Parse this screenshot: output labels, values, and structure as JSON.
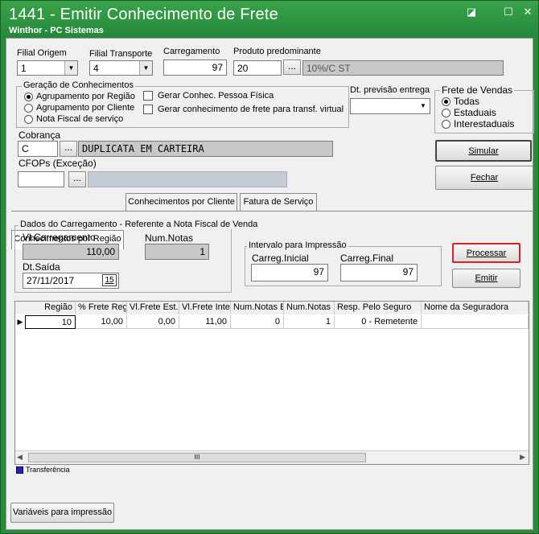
{
  "window": {
    "title": "1441 - Emitir Conhecimento de Frete",
    "subtitle": "Winthor - PC Sistemas",
    "controls": [
      "◪",
      "☐",
      "✕"
    ]
  },
  "header": {
    "filial_origem": {
      "label": "Filial Origem",
      "value": "1"
    },
    "filial_transporte": {
      "label": "Filial Transporte",
      "value": "4"
    },
    "carregamento": {
      "label": "Carregamento",
      "value": "97"
    },
    "produto": {
      "label": "Produto predominante",
      "code": "20",
      "btn": "...",
      "desc": "10%/C ST"
    }
  },
  "geracao": {
    "title": "Geração de Conhecimentos",
    "options": [
      {
        "label": "Agrupamento por Região",
        "checked": true
      },
      {
        "label": "Agrupamento por Cliente",
        "checked": false
      },
      {
        "label": "Nota Fiscal de serviço",
        "checked": false
      }
    ],
    "checks": [
      {
        "label": "Gerar Conhec. Pessoa Física"
      },
      {
        "label": "Gerar conhecimento de frete para transf. virtual"
      }
    ]
  },
  "previsao": {
    "label": "Dt. previsão entrega",
    "value": ""
  },
  "frete_vendas": {
    "title": "Frete de Vendas",
    "options": [
      {
        "label": "Todas",
        "checked": true
      },
      {
        "label": "Estaduais",
        "checked": false
      },
      {
        "label": "Interestaduais",
        "checked": false
      }
    ]
  },
  "cobranca": {
    "label": "Cobrança",
    "code": "C",
    "btn": "...",
    "desc": "DUPLICATA EM CARTEIRA"
  },
  "cfops": {
    "label": "CFOPs  (Exceção)",
    "btn": "..."
  },
  "buttons": {
    "simular": "Simular",
    "fechar": "Fechar",
    "processar": "Processar",
    "emitir": "Emitir",
    "variaveis": "Variáveis para impressão"
  },
  "tabs": [
    "Conhecimentos por Região",
    "Conhecimentos por Cliente",
    "Fatura de Serviço"
  ],
  "dados": {
    "title": "Dados do Carregamento - Referente a Nota Fiscal de Venda",
    "vl_label": "Vl.Carregamento",
    "vl_value": "110,00",
    "num_label": "Num.Notas",
    "num_value": "1",
    "dt_label": "Dt.Saída",
    "dt_value": "27/11/2017",
    "dt_icon": "15"
  },
  "intervalo": {
    "title": "Intervalo para Impressão",
    "inicial_label": "Carreg.Inicial",
    "inicial_value": "97",
    "final_label": "Carreg.Final",
    "final_value": "97"
  },
  "table": {
    "columns": [
      "Região",
      "% Frete Reg",
      "Vl.Frete Est.",
      "Vl.Frete Inte",
      "Num.Notas E",
      "Num.Notas I",
      "Resp. Pelo Seguro",
      "Nome da Seguradora"
    ],
    "rows": [
      [
        "10",
        "10,00",
        "0,00",
        "11,00",
        "0",
        "1",
        "0 - Remetente",
        ""
      ]
    ]
  },
  "scroll": {
    "left": "◀",
    "thumb": "III",
    "right": "▶"
  },
  "legend": {
    "label": "Transferência",
    "color": "#1f1fd0"
  }
}
